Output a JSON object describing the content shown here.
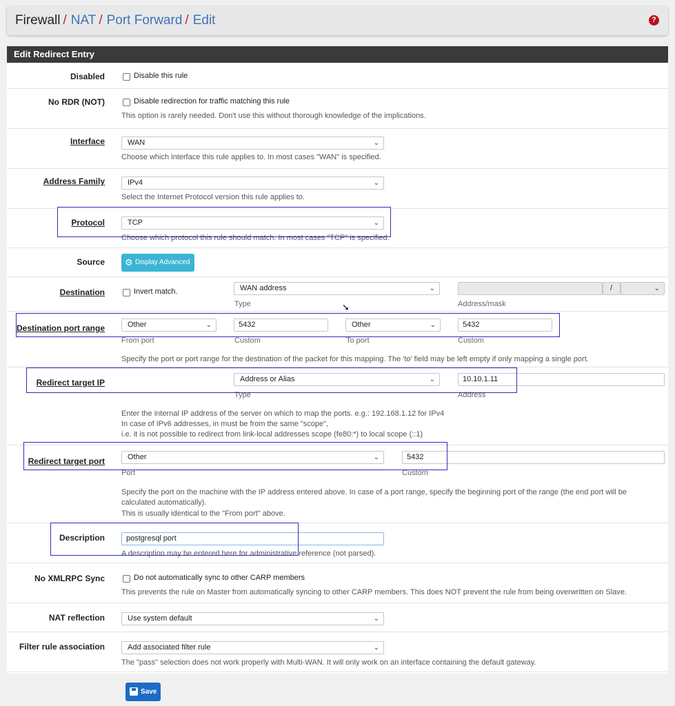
{
  "breadcrumb": {
    "items": [
      "Firewall",
      "NAT",
      "Port Forward",
      "Edit"
    ],
    "separator": "/",
    "help_icon": "question-circle-icon"
  },
  "panel": {
    "title": "Edit Redirect Entry"
  },
  "fields": {
    "disabled": {
      "label": "Disabled",
      "checkbox_label": "Disable this rule"
    },
    "nordr": {
      "label": "No RDR (NOT)",
      "checkbox_label": "Disable redirection for traffic matching this rule",
      "help": "This option is rarely needed. Don't use this without thorough knowledge of the implications."
    },
    "interface": {
      "label": "Interface",
      "value": "WAN",
      "help": "Choose which interface this rule applies to. In most cases \"WAN\" is specified."
    },
    "address_family": {
      "label": "Address Family",
      "value": "IPv4",
      "help": "Select the Internet Protocol version this rule applies to."
    },
    "protocol": {
      "label": "Protocol",
      "value": "TCP",
      "help": "Choose which protocol this rule should match. In most cases \"TCP\" is specified."
    },
    "source": {
      "label": "Source",
      "button": "Display Advanced"
    },
    "destination": {
      "label": "Destination",
      "invert_label": "Invert match.",
      "type_value": "WAN address",
      "type_sub": "Type",
      "address_value": "",
      "mask_sep": "/",
      "address_sub": "Address/mask"
    },
    "dest_port": {
      "label": "Destination port range",
      "from_value": "Other",
      "from_sub": "From port",
      "from_custom": "5432",
      "from_custom_sub": "Custom",
      "to_value": "Other",
      "to_sub": "To port",
      "to_custom": "5432",
      "to_custom_sub": "Custom",
      "help": "Specify the port or port range for the destination of the packet for this mapping. The 'to' field may be left empty if only mapping a single port."
    },
    "redirect_ip": {
      "label": "Redirect target IP",
      "type_value": "Address or Alias",
      "type_sub": "Type",
      "address_value": "10.10.1.11",
      "address_sub": "Address",
      "help1": "Enter the internal IP address of the server on which to map the ports. e.g.: 192.168.1.12 for IPv4",
      "help2": "In case of IPv6 addresses, in must be from the same \"scope\",",
      "help3": "i.e. it is not possible to redirect from link-local addresses scope (fe80:*) to local scope (::1)"
    },
    "redirect_port": {
      "label": "Redirect target port",
      "port_value": "Other",
      "port_sub": "Port",
      "custom_value": "5432",
      "custom_sub": "Custom",
      "help1": "Specify the port on the machine with the IP address entered above. In case of a port range, specify the beginning port of the range (the end port will be",
      "help2": "calculated automatically).",
      "help3": "This is usually identical to the \"From port\" above."
    },
    "description": {
      "label": "Description",
      "value": "postgresql port",
      "help": "A description may be entered here for administrative reference (not parsed)."
    },
    "xmlrpc": {
      "label": "No XMLRPC Sync",
      "checkbox_label": "Do not automatically sync to other CARP members",
      "help": "This prevents the rule on Master from automatically syncing to other CARP members. This does NOT prevent the rule from being overwritten on Slave."
    },
    "nat_reflection": {
      "label": "NAT reflection",
      "value": "Use system default"
    },
    "filter_assoc": {
      "label": "Filter rule association",
      "value": "Add associated filter rule",
      "help": "The \"pass\" selection does not work properly with Multi-WAN. It will only work on an interface containing the default gateway."
    }
  },
  "save_button": {
    "label": "Save",
    "icon": "save-icon"
  },
  "highlight_color": "#2d2fb6"
}
